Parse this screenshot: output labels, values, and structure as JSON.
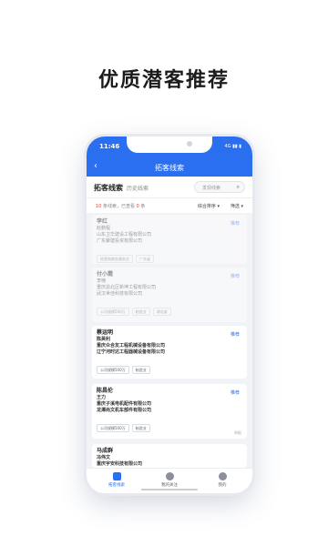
{
  "headline": "优质潜客推荐",
  "status": {
    "time": "11:46",
    "signal": "4G ▮▮ ▮"
  },
  "nav": {
    "back_icon": "chevron-left-icon",
    "title": "拓客线索"
  },
  "tabs": {
    "active": "拓客线索",
    "history": "历史线索",
    "search_placeholder": "发现线索"
  },
  "filters": {
    "count_num": "10",
    "count_text": " 条线索，已查看 ",
    "viewed": "0",
    "viewed_suffix": " 条",
    "sort": "综合排序 ▾",
    "screen": "筛选 ▾"
  },
  "cards": [
    {
      "name": "李红",
      "line1": "赵鹏程",
      "line2": "山东卫华建设工程有限公司",
      "line3": "广东聚建投资有限公司",
      "tags": [
        "经营和商务服务业",
        "广东省"
      ],
      "rec": "推荐",
      "more": ""
    },
    {
      "name": "付小霞",
      "line1": "李楠",
      "line2": "重庆渝北区新坤工程有限公司",
      "line3": "武汉世佳科技有限公司",
      "tags": [
        "公司规模500万",
        "制造业",
        "湖北省"
      ],
      "rec": "推荐",
      "more": ""
    },
    {
      "name": "蔡运明",
      "line1": "陈昊利",
      "line2": "重庆众合友工程机械设备有限公司",
      "line3": "辽宁河时达工程器械设备有限公司",
      "tags": [
        "公司规模500万",
        "制造业"
      ],
      "rec": "推荐",
      "more": ""
    },
    {
      "name": "陈昌伦",
      "line1": "王力",
      "line2": "重庆子溪电机配件有限公司",
      "line3": "龙潭尚文机车部件有限公司",
      "tags": [
        "公司规模500万",
        "制造业"
      ],
      "rec": "推荐",
      "more": "举报"
    },
    {
      "name": "马成群",
      "line1": "冯伟文",
      "line2": "重庆宇安科技有限公司",
      "line3": "",
      "tags": [],
      "rec": "",
      "more": ""
    }
  ],
  "bottom": {
    "tab1": "拓客线索",
    "tab2": "我的关注",
    "tab3": "我的"
  },
  "colors": {
    "primary": "#2a6ff0",
    "accent_red": "#e04545"
  }
}
